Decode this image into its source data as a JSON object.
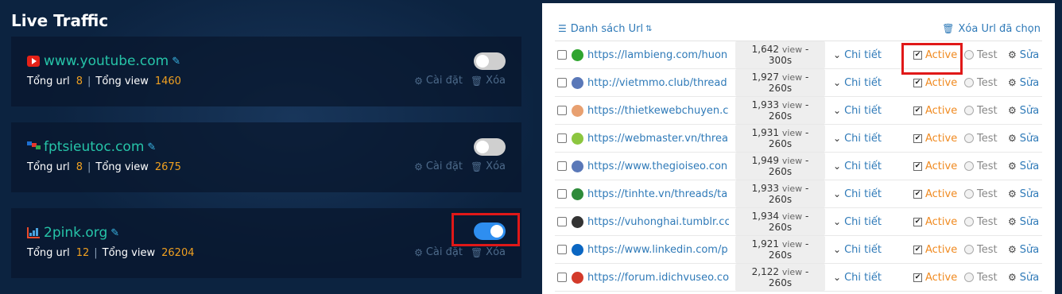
{
  "left": {
    "title": "Live Traffic",
    "sites": [
      {
        "name": "www.youtube.com",
        "total_url_label": "Tổng url",
        "total_url": "8",
        "total_view_label": "Tổng view",
        "total_view": "1460",
        "settings_label": "Cài đặt",
        "delete_label": "Xóa",
        "enabled": false,
        "icon": "youtube-icon"
      },
      {
        "name": "fptsieutoc.com",
        "total_url_label": "Tổng url",
        "total_url": "8",
        "total_view_label": "Tổng view",
        "total_view": "2675",
        "settings_label": "Cài đặt",
        "delete_label": "Xóa",
        "enabled": false,
        "icon": "fpt-icon"
      },
      {
        "name": "2pink.org",
        "total_url_label": "Tổng url",
        "total_url": "12",
        "total_view_label": "Tổng view",
        "total_view": "26204",
        "settings_label": "Cài đặt",
        "delete_label": "Xóa",
        "enabled": true,
        "icon": "chart-icon"
      }
    ]
  },
  "right": {
    "list_title": "Danh sách Url",
    "delete_selected": "Xóa Url đã chọn",
    "rows": [
      {
        "url": "https://lambieng.com/huon",
        "views": "1,642",
        "view_word": "view",
        "secs": "300s",
        "detail": "Chi tiết",
        "active": "Active",
        "test": "Test",
        "edit": "Sửa",
        "favicon_color": "#2fa52f"
      },
      {
        "url": "http://vietmmo.club/thread",
        "views": "1,927",
        "view_word": "view",
        "secs": "260s",
        "detail": "Chi tiết",
        "active": "Active",
        "test": "Test",
        "edit": "Sửa",
        "favicon_color": "#5a78b8"
      },
      {
        "url": "https://thietkewebchuyen.c",
        "views": "1,933",
        "view_word": "view",
        "secs": "260s",
        "detail": "Chi tiết",
        "active": "Active",
        "test": "Test",
        "edit": "Sửa",
        "favicon_color": "#e8a070"
      },
      {
        "url": "https://webmaster.vn/threa",
        "views": "1,931",
        "view_word": "view",
        "secs": "260s",
        "detail": "Chi tiết",
        "active": "Active",
        "test": "Test",
        "edit": "Sửa",
        "favicon_color": "#8cc63f"
      },
      {
        "url": "https://www.thegioiseo.con",
        "views": "1,949",
        "view_word": "view",
        "secs": "260s",
        "detail": "Chi tiết",
        "active": "Active",
        "test": "Test",
        "edit": "Sửa",
        "favicon_color": "#5a78b8"
      },
      {
        "url": "https://tinhte.vn/threads/ta",
        "views": "1,933",
        "view_word": "view",
        "secs": "260s",
        "detail": "Chi tiết",
        "active": "Active",
        "test": "Test",
        "edit": "Sửa",
        "favicon_color": "#2e8b3a"
      },
      {
        "url": "https://vuhonghai.tumblr.cc",
        "views": "1,934",
        "view_word": "view",
        "secs": "260s",
        "detail": "Chi tiết",
        "active": "Active",
        "test": "Test",
        "edit": "Sửa",
        "favicon_color": "#333333"
      },
      {
        "url": "https://www.linkedin.com/p",
        "views": "1,921",
        "view_word": "view",
        "secs": "260s",
        "detail": "Chi tiết",
        "active": "Active",
        "test": "Test",
        "edit": "Sửa",
        "favicon_color": "#0a66c2"
      },
      {
        "url": "https://forum.idichvuseo.co",
        "views": "2,122",
        "view_word": "view",
        "secs": "260s",
        "detail": "Chi tiết",
        "active": "Active",
        "test": "Test",
        "edit": "Sửa",
        "favicon_color": "#d33a2a"
      }
    ]
  }
}
